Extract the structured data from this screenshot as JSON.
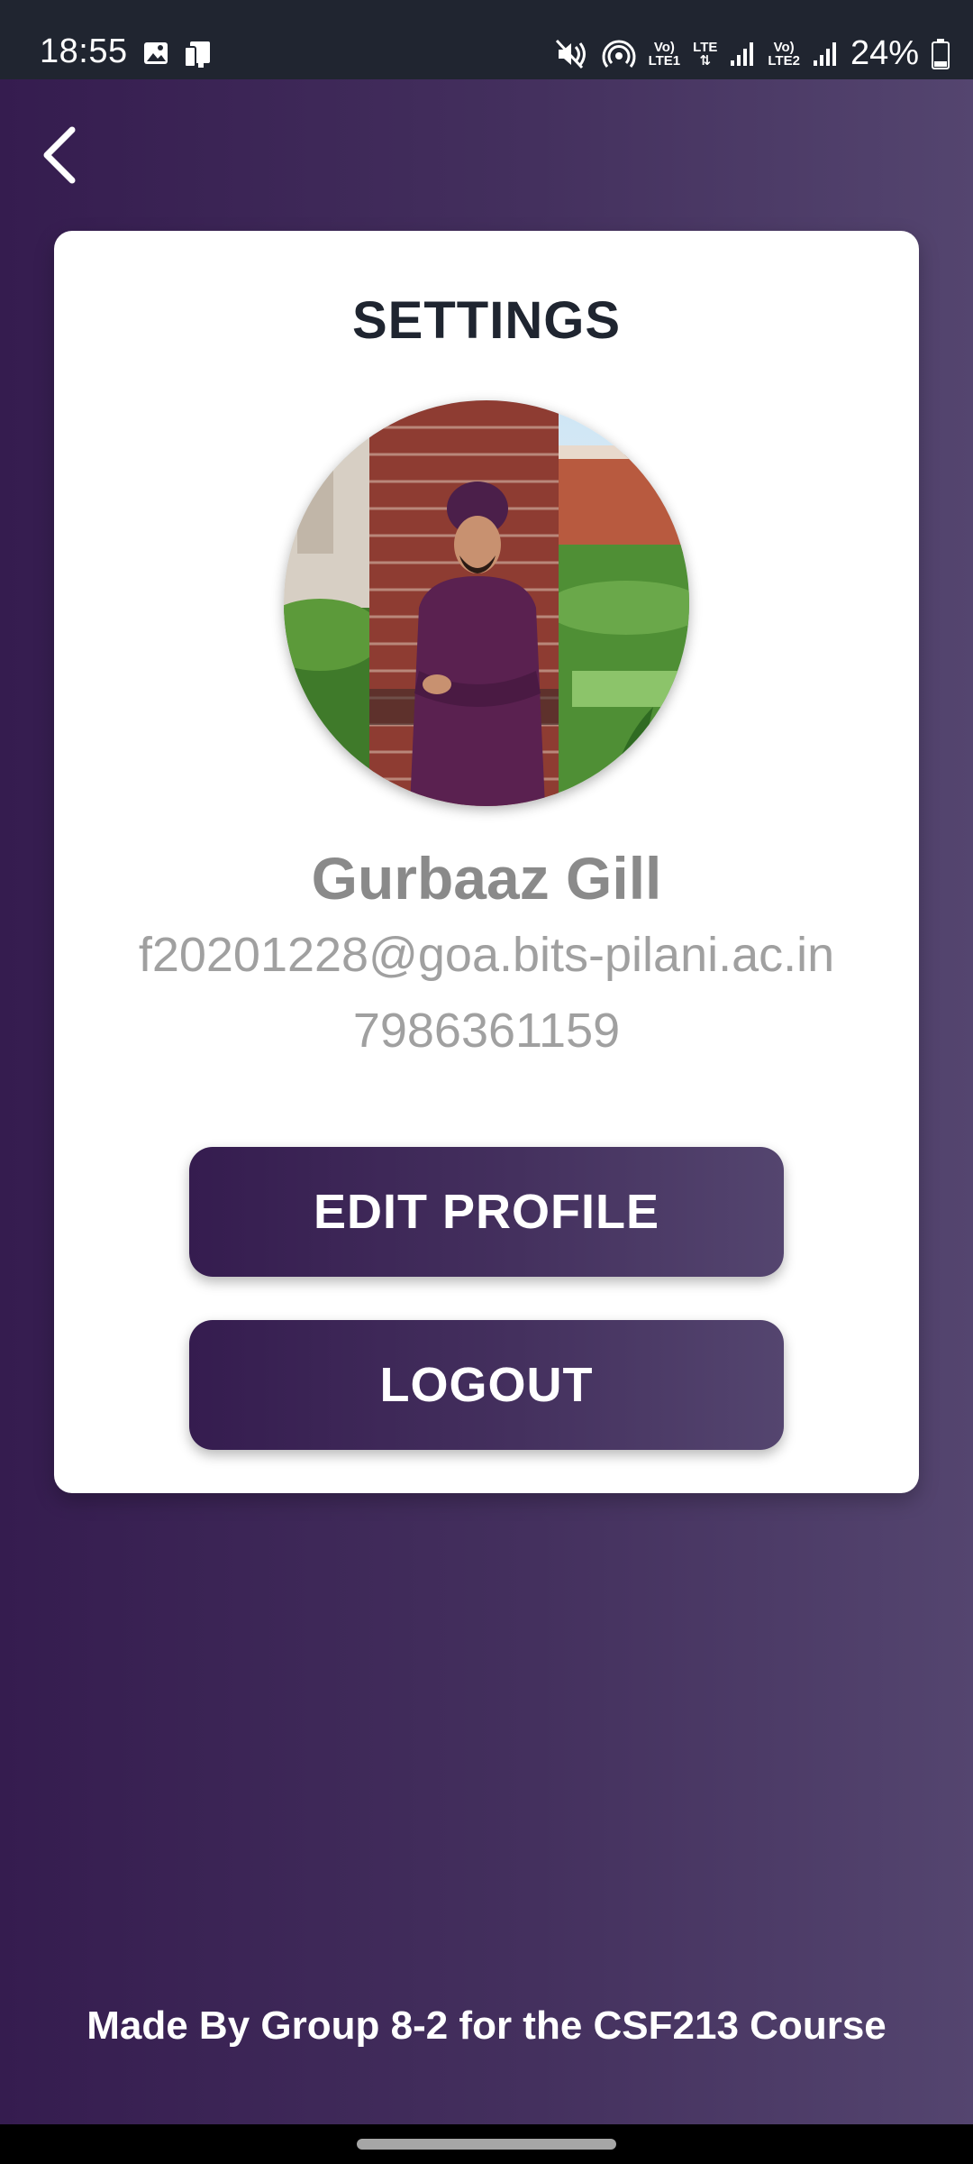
{
  "status_bar": {
    "time": "18:55",
    "battery_percent": "24%",
    "sim1_label_top": "Vo)",
    "sim1_label_bottom": "LTE1",
    "data_label": "LTE",
    "sim2_label_top": "Vo)",
    "sim2_label_bottom": "LTE2",
    "icons": [
      "gallery-icon",
      "device-icon",
      "mute-icon",
      "hotspot-icon",
      "signal-icon",
      "battery-icon"
    ]
  },
  "header": {
    "back_icon": "chevron-left-icon"
  },
  "settings": {
    "title": "SETTINGS",
    "user_name": "Gurbaaz Gill",
    "email": "f20201228@goa.bits-pilani.ac.in",
    "phone": "7986361159",
    "edit_profile_label": "EDIT PROFILE",
    "logout_label": "LOGOUT"
  },
  "footer": {
    "credit": "Made By Group 8-2 for the CSF213 Course"
  },
  "colors": {
    "gradient_start": "#351c4f",
    "gradient_end": "#54456f",
    "title_text": "#1f2530",
    "muted_text": "#a0a0a0",
    "status_bar": "#202530"
  }
}
